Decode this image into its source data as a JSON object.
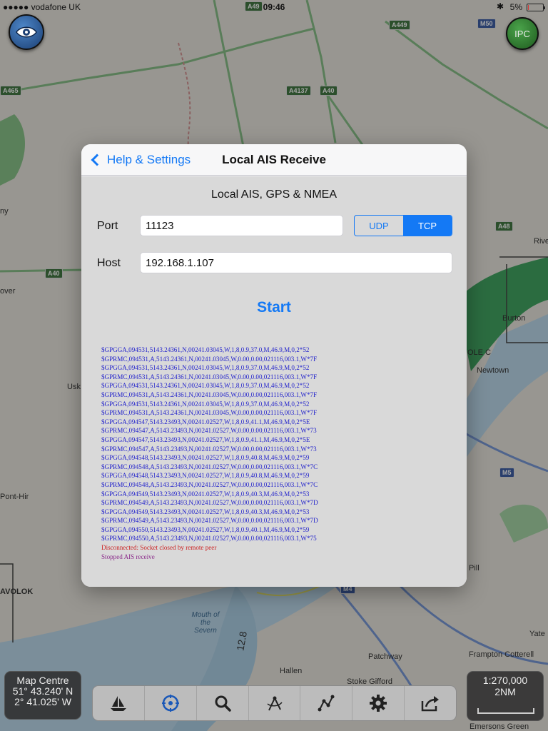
{
  "status_bar": {
    "carrier": "●●●●● vodafone UK",
    "time": "09:46",
    "battery_text": "5%",
    "battery_level": 0.05
  },
  "map": {
    "labels": [
      "ny",
      "over",
      "Usk",
      "Pont-Hir",
      "AVOLOK",
      "Mouth of the Severn",
      "12.8",
      "Burton",
      "OLE C",
      "Newtown",
      "Pill",
      "Yate",
      "Frampton Cotterell",
      "Patchway",
      "Hallen",
      "Stoke Gifford",
      "Emersons Green",
      "Rive"
    ],
    "roads": [
      "A49",
      "A449",
      "M50",
      "A465",
      "A4137",
      "A40",
      "A40",
      "A48",
      "M5",
      "M4"
    ]
  },
  "top_buttons": {
    "eye_icon": "eye-icon",
    "ipc_label": "IPC"
  },
  "modal": {
    "back_label": "Help & Settings",
    "title": "Local AIS Receive",
    "section_heading": "Local AIS, GPS & NMEA",
    "port_label": "Port",
    "port_value": "11123",
    "host_label": "Host",
    "host_value": "192.168.1.107",
    "protocol_options": [
      "UDP",
      "TCP"
    ],
    "protocol_selected": "TCP",
    "start_label": "Start",
    "log_lines": [
      "$GPGGA,094531,5143.24361,N,00241.03045,W,1,8,0.9,37.0,M,46.9,M,0,2*52",
      "$GPRMC,094531,A,5143.24361,N,00241.03045,W,0.00,0.00,021116,003.1,W*7F",
      "$GPGGA,094531,5143.24361,N,00241.03045,W,1,8,0.9,37.0,M,46.9,M,0,2*52",
      "$GPRMC,094531,A,5143.24361,N,00241.03045,W,0.00,0.00,021116,003.1,W*7F",
      "$GPGGA,094531,5143.24361,N,00241.03045,W,1,8,0.9,37.0,M,46.9,M,0,2*52",
      "$GPRMC,094531,A,5143.24361,N,00241.03045,W,0.00,0.00,021116,003.1,W*7F",
      "$GPGGA,094531,5143.24361,N,00241.03045,W,1,8,0.9,37.0,M,46.9,M,0,2*52",
      "$GPRMC,094531,A,5143.24361,N,00241.03045,W,0.00,0.00,021116,003.1,W*7F",
      "$GPGGA,094547,5143.23493,N,00241.02527,W,1,8,0.9,41.1,M,46.9,M,0,2*5E",
      "$GPRMC,094547,A,5143.23493,N,00241.02527,W,0.00,0.00,021116,003.1,W*73",
      "$GPGGA,094547,5143.23493,N,00241.02527,W,1,8,0.9,41.1,M,46.9,M,0,2*5E",
      "$GPRMC,094547,A,5143.23493,N,00241.02527,W,0.00,0.00,021116,003.1,W*73",
      "$GPGGA,094548,5143.23493,N,00241.02527,W,1,8,0.9,40.8,M,46.9,M,0,2*59",
      "$GPRMC,094548,A,5143.23493,N,00241.02527,W,0.00,0.00,021116,003.1,W*7C",
      "$GPGGA,094548,5143.23493,N,00241.02527,W,1,8,0.9,40.8,M,46.9,M,0,2*59",
      "$GPRMC,094548,A,5143.23493,N,00241.02527,W,0.00,0.00,021116,003.1,W*7C",
      "$GPGGA,094549,5143.23493,N,00241.02527,W,1,8,0.9,40.3,M,46.9,M,0,2*53",
      "$GPRMC,094549,A,5143.23493,N,00241.02527,W,0.00,0.00,021116,003.1,W*7D",
      "$GPGGA,094549,5143.23493,N,00241.02527,W,1,8,0.9,40.3,M,46.9,M,0,2*53",
      "$GPRMC,094549,A,5143.23493,N,00241.02527,W,0.00,0.00,021116,003.1,W*7D",
      "$GPGGA,094550,5143.23493,N,00241.02527,W,1,8,0.9,40.1,M,46.9,M,0,2*59",
      "$GPRMC,094550,A,5143.23493,N,00241.02527,W,0.00,0.00,021116,003.1,W*75"
    ],
    "error_line": "Disconnected: Socket closed by remote peer",
    "info_line": "Stopped AIS receive"
  },
  "map_centre": {
    "title": "Map Centre",
    "lat": "51° 43.240' N",
    "lon": "2° 41.025' W"
  },
  "toolbar": {
    "icons": [
      "sailboat-icon",
      "compass-icon",
      "search-icon",
      "dividers-icon",
      "route-icon",
      "gear-icon",
      "share-icon"
    ]
  },
  "scale": {
    "ratio": "1:270,000",
    "distance": "2NM"
  },
  "colors": {
    "accent": "#1479f5",
    "log_nmea": "#2222cc",
    "log_error": "#cc2222",
    "log_info": "#8a2a8a",
    "water": "#b7d7ec",
    "land": "#e8e6dc",
    "forest": "#2e9e52"
  }
}
